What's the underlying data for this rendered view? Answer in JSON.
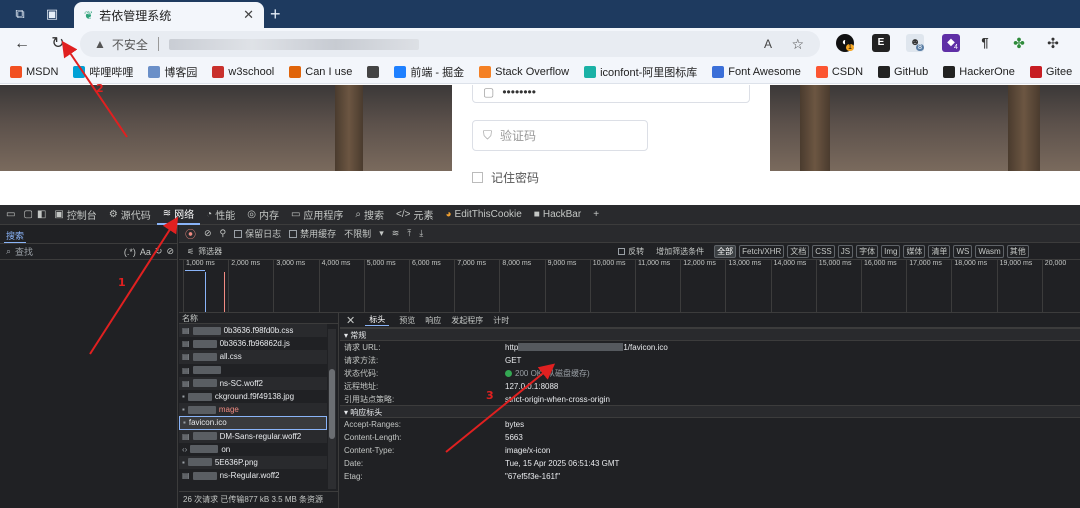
{
  "browser": {
    "tab_title": "若依管理系统",
    "new_tab": "+",
    "tab_close": "✕",
    "security_label": "不安全",
    "read_aloud": "A",
    "bookmarks": [
      {
        "label": "MSDN",
        "icon": "msdn-icon",
        "color": "#f25022"
      },
      {
        "label": "哔哩哔哩",
        "icon": "bilibili-icon",
        "color": "#00a1d6"
      },
      {
        "label": "博客园",
        "icon": "cnblogs-icon",
        "color": "#6a8fc8"
      },
      {
        "label": "w3school",
        "icon": "w3school-icon",
        "color": "#c9302c"
      },
      {
        "label": "Can I use",
        "icon": "caniuse-icon",
        "color": "#e0640a"
      },
      {
        "label": "",
        "icon": "globe-icon",
        "color": "#444444"
      },
      {
        "label": "前端 - 掘金",
        "icon": "juejin-icon",
        "color": "#1e80ff"
      },
      {
        "label": "Stack Overflow",
        "icon": "stackoverflow-icon",
        "color": "#f48024"
      },
      {
        "label": "iconfont-阿里图标库",
        "icon": "iconfont-icon",
        "color": "#1ab1a5"
      },
      {
        "label": "Font Awesome",
        "icon": "fontawesome-icon",
        "color": "#3b6fd8"
      },
      {
        "label": "CSDN",
        "icon": "csdn-icon",
        "color": "#fc5531"
      },
      {
        "label": "GitHub",
        "icon": "github-icon",
        "color": "#222222"
      },
      {
        "label": "HackerOne",
        "icon": "hackerone-icon",
        "color": "#222222"
      },
      {
        "label": "Gitee",
        "icon": "gitee-icon",
        "color": "#c71d23"
      }
    ],
    "extension_badges": {
      "ext1": "1",
      "ext3": "8",
      "ext4": "4"
    }
  },
  "page": {
    "password_mask": "••••••••",
    "captcha_placeholder": "验证码",
    "remember_label": "记住密码"
  },
  "devtools": {
    "tabs": [
      "控制台",
      "源代码",
      "网络",
      "性能",
      "内存",
      "应用程序",
      "搜索",
      "元素",
      "EditThisCookie",
      "HackBar"
    ],
    "search_panel_tab": "搜索",
    "search_placeholder": "查找",
    "regex_label": "(.*)",
    "case_label": "Aa",
    "preserve_log": "保留日志",
    "disable_cache": "禁用缓存",
    "throttle": "不限制",
    "filter_placeholder": "筛选器",
    "invert": "反转",
    "more_filters": "增加筛选条件",
    "filter_chips": [
      "全部",
      "Fetch/XHR",
      "文档",
      "CSS",
      "JS",
      "字体",
      "Img",
      "媒体",
      "清单",
      "WS",
      "Wasm",
      "其他"
    ],
    "timeline_ticks": [
      "1,000 ms",
      "2,000 ms",
      "3,000 ms",
      "4,000 ms",
      "5,000 ms",
      "6,000 ms",
      "7,000 ms",
      "8,000 ms",
      "9,000 ms",
      "10,000 ms",
      "11,000 ms",
      "12,000 ms",
      "13,000 ms",
      "14,000 ms",
      "15,000 ms",
      "16,000 ms",
      "17,000 ms",
      "18,000 ms",
      "19,000 ms",
      "20,000"
    ],
    "name_header": "名称",
    "requests": [
      {
        "name": "0b3636.f98fd0b.css",
        "sel": false
      },
      {
        "name": "0b3636.fb96862d.js",
        "sel": false
      },
      {
        "name": "all.css",
        "sel": false
      },
      {
        "name": "",
        "sel": false
      },
      {
        "name": "ns-SC.woff2",
        "sel": false
      },
      {
        "name": "ckground.f9f49138.jpg",
        "sel": false
      },
      {
        "name": "mage",
        "sel": false
      },
      {
        "name": "favicon.ico",
        "sel": true
      },
      {
        "name": "DM-Sans-regular.woff2",
        "sel": false
      },
      {
        "name": "on",
        "sel": false
      },
      {
        "name": "5E636P.png",
        "sel": false
      },
      {
        "name": "ns-Regular.woff2",
        "sel": false
      }
    ],
    "summary": "26 次请求  已传输877 kB  3.5 MB 条资源",
    "detail_tabs": [
      "标头",
      "预览",
      "响应",
      "发起程序",
      "计时"
    ],
    "general_title": "常规",
    "general": [
      {
        "k": "请求 URL:",
        "v": "1/favicon.ico",
        "pre": "http"
      },
      {
        "k": "请求方法:",
        "v": "GET"
      },
      {
        "k": "状态代码:",
        "v": "200 OK (从磁盘缓存)"
      },
      {
        "k": "远程地址:",
        "v": "127.0.0.1:8088"
      },
      {
        "k": "引用站点策略:",
        "v": "strict-origin-when-cross-origin"
      }
    ],
    "response_title": "响应标头",
    "response": [
      {
        "k": "Accept-Ranges:",
        "v": "bytes"
      },
      {
        "k": "Content-Length:",
        "v": "5663"
      },
      {
        "k": "Content-Type:",
        "v": "image/x-icon"
      },
      {
        "k": "Date:",
        "v": "Tue, 15 Apr 2025 06:51:43 GMT"
      },
      {
        "k": "Etag:",
        "v": "\"67ef5f3e-161f\""
      }
    ]
  },
  "annotations": [
    "1",
    "2",
    "3"
  ],
  "colors": {
    "accent": "#8ab4f8",
    "arrow": "#e02020",
    "tabstrip": "#1e3a5f"
  }
}
